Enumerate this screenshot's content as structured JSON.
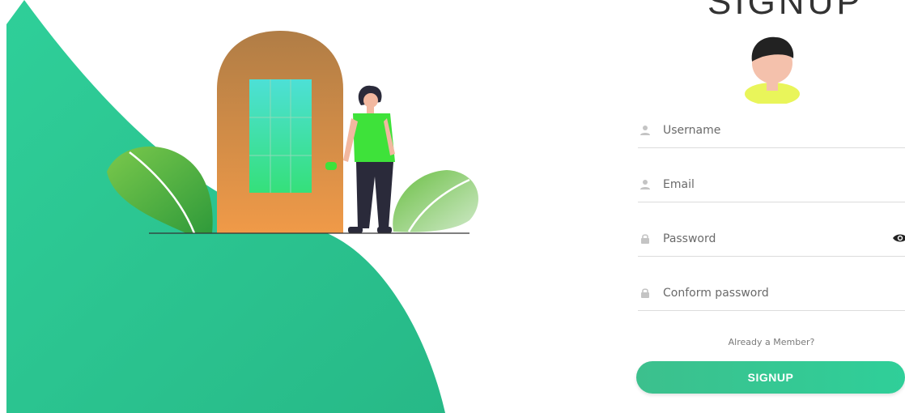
{
  "form": {
    "heading": "SIGNUP",
    "fields": [
      {
        "placeholder": "Username",
        "value": "",
        "icon": "user-icon"
      },
      {
        "placeholder": "Email",
        "value": "",
        "icon": "user-icon"
      },
      {
        "placeholder": "Password",
        "value": "",
        "icon": "lock-icon"
      },
      {
        "placeholder": "Conform password",
        "value": "",
        "icon": "lock-icon"
      }
    ],
    "member_link": "Already a Member?",
    "submit_label": "SIGNUP"
  },
  "colors": {
    "accent": "#2fcf99",
    "accent_dark": "#3cc08d",
    "shirt": "#3ee23a",
    "door": "#e7954a"
  }
}
